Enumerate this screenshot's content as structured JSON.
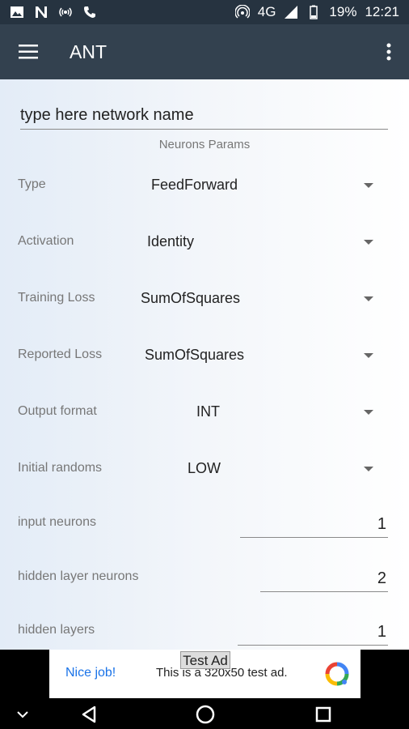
{
  "status_bar": {
    "network": "4G",
    "battery": "19%",
    "time": "12:21",
    "icons": [
      "image-icon",
      "n-icon",
      "broadcast-icon",
      "phone-icon",
      "hotspot-icon",
      "signal-icon",
      "battery-icon"
    ]
  },
  "app_bar": {
    "title": "ANT",
    "menu_icon": "hamburger-menu-icon",
    "more_icon": "more-vert-icon"
  },
  "form": {
    "name_placeholder": "type here network name",
    "section_title": "Neurons Params",
    "dropdowns": [
      {
        "label": "Type",
        "value": "FeedForward"
      },
      {
        "label": "Activation",
        "value": "Identity"
      },
      {
        "label": "Training Loss",
        "value": "SumOfSquares"
      },
      {
        "label": "Reported Loss",
        "value": "SumOfSquares"
      },
      {
        "label": "Output format",
        "value": "INT"
      },
      {
        "label": "Initial randoms",
        "value": "LOW"
      }
    ],
    "numbers": [
      {
        "label": "input neurons",
        "value": "1"
      },
      {
        "label": "hidden layer neurons",
        "value": "2"
      },
      {
        "label": "hidden layers",
        "value": "1"
      }
    ]
  },
  "ad": {
    "badge": "Test Ad",
    "cta": "Nice job!",
    "text": "This is a 320x50 test ad."
  },
  "nav_bar": {
    "icons": [
      "keyboard-hide-icon",
      "back-icon",
      "home-icon",
      "recents-icon"
    ]
  }
}
